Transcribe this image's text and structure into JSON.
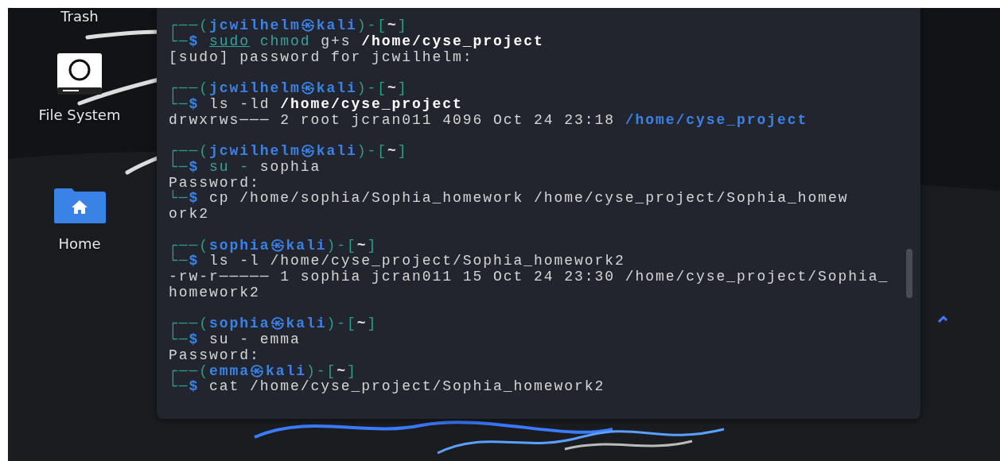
{
  "desktop_icons": [
    {
      "kind": "trash",
      "label": "Trash"
    },
    {
      "kind": "drive",
      "label": "File System"
    },
    {
      "kind": "home",
      "label": "Home"
    }
  ],
  "terminal": {
    "lines": [
      {
        "kind": "text",
        "segments": [
          {
            "text": "┌──(",
            "kind": "frame"
          },
          {
            "text": "jcwilhelm㉿kali",
            "kind": "user"
          },
          {
            "text": ")-[",
            "kind": "frame"
          },
          {
            "text": "~",
            "kind": "dir"
          },
          {
            "text": "]",
            "kind": "frame"
          }
        ]
      },
      {
        "kind": "text",
        "segments": [
          {
            "text": "└─",
            "kind": "frame"
          },
          {
            "text": "$ ",
            "kind": "dollar"
          },
          {
            "text": "sudo",
            "kind": "sudo"
          },
          {
            "text": " chmod",
            "kind": "cmd"
          },
          {
            "text": " g+s ",
            "kind": "plain"
          },
          {
            "text": "/home/cyse_project",
            "kind": "bold"
          }
        ]
      },
      {
        "kind": "text",
        "segments": [
          {
            "text": "[sudo] password for jcwilhelm:",
            "kind": "plain"
          }
        ]
      },
      {
        "kind": "blank"
      },
      {
        "kind": "text",
        "segments": [
          {
            "text": "┌──(",
            "kind": "frame"
          },
          {
            "text": "jcwilhelm㉿kali",
            "kind": "user"
          },
          {
            "text": ")-[",
            "kind": "frame"
          },
          {
            "text": "~",
            "kind": "dir"
          },
          {
            "text": "]",
            "kind": "frame"
          }
        ]
      },
      {
        "kind": "text",
        "segments": [
          {
            "text": "└─",
            "kind": "frame"
          },
          {
            "text": "$ ",
            "kind": "dollar"
          },
          {
            "text": "ls -ld ",
            "kind": "plain"
          },
          {
            "text": "/home/cyse_project",
            "kind": "bold"
          }
        ]
      },
      {
        "kind": "text",
        "segments": [
          {
            "text": "drwxrws─── 2 root jcran011 4096 Oct 24 23:18 ",
            "kind": "plain"
          },
          {
            "text": "/home/cyse_project",
            "kind": "link"
          }
        ]
      },
      {
        "kind": "blank"
      },
      {
        "kind": "text",
        "segments": [
          {
            "text": "┌──(",
            "kind": "frame"
          },
          {
            "text": "jcwilhelm㉿kali",
            "kind": "user"
          },
          {
            "text": ")-[",
            "kind": "frame"
          },
          {
            "text": "~",
            "kind": "dir"
          },
          {
            "text": "]",
            "kind": "frame"
          }
        ]
      },
      {
        "kind": "text",
        "segments": [
          {
            "text": "└─",
            "kind": "frame"
          },
          {
            "text": "$ ",
            "kind": "dollar"
          },
          {
            "text": "su -",
            "kind": "cmd"
          },
          {
            "text": " sophia",
            "kind": "plain"
          }
        ]
      },
      {
        "kind": "text",
        "segments": [
          {
            "text": "Password:",
            "kind": "plain"
          }
        ]
      },
      {
        "kind": "text",
        "segments": [
          {
            "text": "└─",
            "kind": "frame"
          },
          {
            "text": "$ ",
            "kind": "dollar"
          },
          {
            "text": "cp /home/sophia/Sophia_homework /home/cyse_project/Sophia_homew",
            "kind": "plain"
          }
        ]
      },
      {
        "kind": "text",
        "segments": [
          {
            "text": "ork2",
            "kind": "plain"
          }
        ]
      },
      {
        "kind": "blank"
      },
      {
        "kind": "text",
        "segments": [
          {
            "text": "┌──(",
            "kind": "frame"
          },
          {
            "text": "sophia㉿kali",
            "kind": "user"
          },
          {
            "text": ")-[",
            "kind": "frame"
          },
          {
            "text": "~",
            "kind": "dir"
          },
          {
            "text": "]",
            "kind": "frame"
          }
        ]
      },
      {
        "kind": "text",
        "segments": [
          {
            "text": "└─",
            "kind": "frame"
          },
          {
            "text": "$ ",
            "kind": "dollar"
          },
          {
            "text": "ls -l /home/cyse_project/Sophia_homework2",
            "kind": "plain"
          }
        ]
      },
      {
        "kind": "text",
        "segments": [
          {
            "text": "-rw-r───── 1 sophia jcran011 15 Oct 24 23:30 /home/cyse_project/Sophia_",
            "kind": "plain"
          }
        ]
      },
      {
        "kind": "text",
        "segments": [
          {
            "text": "homework2",
            "kind": "plain"
          }
        ]
      },
      {
        "kind": "blank"
      },
      {
        "kind": "text",
        "segments": [
          {
            "text": "┌──(",
            "kind": "frame"
          },
          {
            "text": "sophia㉿kali",
            "kind": "user"
          },
          {
            "text": ")-[",
            "kind": "frame"
          },
          {
            "text": "~",
            "kind": "dir"
          },
          {
            "text": "]",
            "kind": "frame"
          }
        ]
      },
      {
        "kind": "text",
        "segments": [
          {
            "text": "└─",
            "kind": "frame"
          },
          {
            "text": "$ ",
            "kind": "dollar"
          },
          {
            "text": "su - emma",
            "kind": "plain"
          }
        ]
      },
      {
        "kind": "text",
        "segments": [
          {
            "text": "Password:",
            "kind": "plain"
          }
        ]
      },
      {
        "kind": "text",
        "segments": [
          {
            "text": "┌──(",
            "kind": "frame"
          },
          {
            "text": "emma㉿kali",
            "kind": "user"
          },
          {
            "text": ")-[",
            "kind": "frame"
          },
          {
            "text": "~",
            "kind": "dir"
          },
          {
            "text": "]",
            "kind": "frame"
          }
        ]
      },
      {
        "kind": "text",
        "segments": [
          {
            "text": "└─",
            "kind": "frame"
          },
          {
            "text": "$ ",
            "kind": "dollar"
          },
          {
            "text": "cat /home/cyse_project/Sophia_homework2",
            "kind": "plain"
          }
        ]
      }
    ]
  }
}
